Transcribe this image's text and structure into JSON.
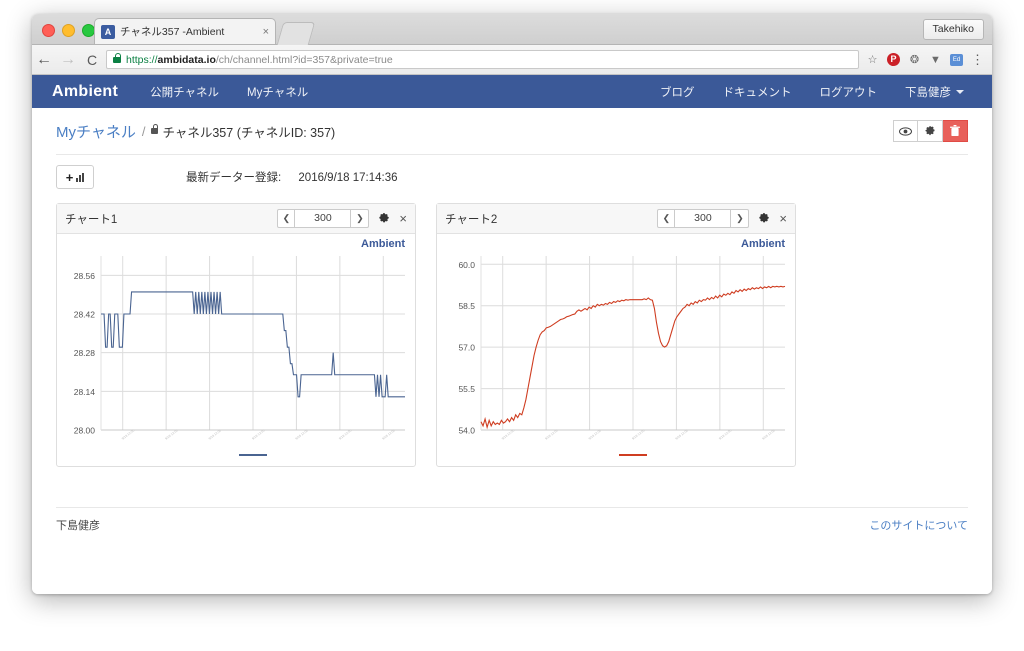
{
  "browser": {
    "tab_favicon": "A",
    "tab_title": "チャネル357 -Ambient",
    "tab_close_icon": "×",
    "profile_label": "Takehiko",
    "back_icon": "←",
    "forward_icon": "→",
    "reload_icon": "C",
    "url_scheme": "https://",
    "url_host": "ambidata.io",
    "url_path": "/ch/channel.html?id=357&private=true",
    "star_icon": "☆",
    "pinterest_icon": "P",
    "ext_icon": "❂",
    "shield_icon": "▼",
    "bluebox_icon": "Ed",
    "kebab_icon": "⋮"
  },
  "navbar": {
    "brand": "Ambient",
    "left_links": [
      {
        "label": "公開チャネル"
      },
      {
        "label": "Myチャネル"
      }
    ],
    "right_links": [
      {
        "label": "ブログ"
      },
      {
        "label": "ドキュメント"
      },
      {
        "label": "ログアウト"
      }
    ],
    "user": "下島健彦"
  },
  "titlerow": {
    "breadcrumb_link": "Myチャネル",
    "separator": "/",
    "channel_text": "チャネル357 (チャネルID: 357)",
    "view_icon": "👁",
    "settings_icon": "✿",
    "delete_icon": "🗑"
  },
  "toolbar": {
    "add_chart_plus": "+",
    "latest_label": "最新データー登録:",
    "latest_value": "2016/9/18 17:14:36"
  },
  "charts": [
    {
      "title": "チャート1",
      "prev_icon": "❮",
      "count": "300",
      "next_icon": "❯",
      "gear_icon": "✿",
      "close_icon": "×",
      "watermark": "Ambient"
    },
    {
      "title": "チャート2",
      "prev_icon": "❮",
      "count": "300",
      "next_icon": "❯",
      "gear_icon": "✿",
      "close_icon": "×",
      "watermark": "Ambient"
    }
  ],
  "footer": {
    "left": "下島健彦",
    "right_link": "このサイトについて"
  },
  "chart_data": [
    {
      "type": "line",
      "title": "チャート1",
      "xlabel": "",
      "ylabel": "",
      "grid": true,
      "legend_position": "bottom",
      "line_color": "#4a6491",
      "ylim": [
        28.0,
        28.63
      ],
      "yticks": [
        28.0,
        28.14,
        28.28,
        28.42,
        28.56
      ],
      "ytick_labels": [
        "28.00",
        "28.14",
        "28.28",
        "28.42",
        "28.56"
      ],
      "xticks": 7,
      "xtick_labels": [
        "",
        "",
        "",
        "",
        "",
        "",
        ""
      ],
      "n_points": 300,
      "values": [
        28.42,
        28.42,
        28.42,
        28.3,
        28.3,
        28.42,
        28.42,
        28.3,
        28.3,
        28.42,
        28.42,
        28.42,
        28.3,
        28.3,
        28.3,
        28.42,
        28.42,
        28.42,
        28.42,
        28.42,
        28.5,
        28.5,
        28.5,
        28.5,
        28.5,
        28.5,
        28.5,
        28.5,
        28.5,
        28.5,
        28.5,
        28.5,
        28.5,
        28.5,
        28.5,
        28.5,
        28.5,
        28.5,
        28.5,
        28.5,
        28.5,
        28.5,
        28.5,
        28.5,
        28.5,
        28.5,
        28.5,
        28.5,
        28.5,
        28.5,
        28.5,
        28.5,
        28.5,
        28.5,
        28.5,
        28.5,
        28.5,
        28.5,
        28.5,
        28.5,
        28.5,
        28.42,
        28.5,
        28.42,
        28.5,
        28.42,
        28.5,
        28.42,
        28.5,
        28.42,
        28.5,
        28.42,
        28.5,
        28.42,
        28.5,
        28.42,
        28.5,
        28.42,
        28.5,
        28.42,
        28.42,
        28.42,
        28.42,
        28.42,
        28.42,
        28.42,
        28.42,
        28.42,
        28.42,
        28.42,
        28.42,
        28.42,
        28.42,
        28.42,
        28.42,
        28.42,
        28.42,
        28.42,
        28.42,
        28.42,
        28.42,
        28.42,
        28.42,
        28.42,
        28.42,
        28.42,
        28.42,
        28.42,
        28.42,
        28.42,
        28.42,
        28.42,
        28.42,
        28.42,
        28.42,
        28.42,
        28.42,
        28.42,
        28.42,
        28.42,
        28.36,
        28.36,
        28.3,
        28.3,
        28.24,
        28.24,
        28.2,
        28.2,
        28.2,
        28.12,
        28.12,
        28.2,
        28.2,
        28.2,
        28.2,
        28.2,
        28.2,
        28.2,
        28.2,
        28.2,
        28.2,
        28.2,
        28.2,
        28.2,
        28.2,
        28.2,
        28.2,
        28.2,
        28.2,
        28.2,
        28.2,
        28.2,
        28.28,
        28.2,
        28.2,
        28.2,
        28.2,
        28.2,
        28.2,
        28.2,
        28.2,
        28.2,
        28.2,
        28.2,
        28.2,
        28.2,
        28.2,
        28.2,
        28.2,
        28.2,
        28.2,
        28.2,
        28.2,
        28.2,
        28.2,
        28.2,
        28.2,
        28.2,
        28.2,
        28.2,
        28.12,
        28.2,
        28.12,
        28.2,
        28.12,
        28.12,
        28.12,
        28.2,
        28.12,
        28.12,
        28.12,
        28.12,
        28.12,
        28.12,
        28.12,
        28.12,
        28.12,
        28.12,
        28.12,
        28.12
      ]
    },
    {
      "type": "line",
      "title": "チャート2",
      "xlabel": "",
      "ylabel": "",
      "grid": true,
      "legend_position": "bottom",
      "line_color": "#cf3d21",
      "ylim": [
        54.0,
        60.3
      ],
      "yticks": [
        54.0,
        55.5,
        57.0,
        58.5,
        60.0
      ],
      "ytick_labels": [
        "54.0",
        "55.5",
        "57.0",
        "58.5",
        "60.0"
      ],
      "xticks": 7,
      "xtick_labels": [
        "",
        "",
        "",
        "",
        "",
        "",
        ""
      ],
      "n_points": 300,
      "values": [
        54.3,
        54.15,
        54.4,
        54.1,
        54.35,
        54.15,
        54.3,
        54.2,
        54.25,
        54.2,
        54.35,
        54.25,
        54.3,
        54.4,
        54.3,
        54.45,
        54.35,
        54.55,
        54.45,
        54.6,
        54.55,
        54.8,
        55.1,
        55.5,
        55.9,
        56.3,
        56.7,
        57.0,
        57.25,
        57.45,
        57.55,
        57.6,
        57.7,
        57.72,
        57.75,
        57.8,
        57.85,
        57.9,
        57.95,
        58.0,
        58.02,
        58.05,
        58.1,
        58.12,
        58.15,
        58.18,
        58.2,
        58.3,
        58.35,
        58.3,
        58.35,
        58.4,
        58.35,
        58.45,
        58.4,
        58.5,
        58.45,
        58.55,
        58.5,
        58.55,
        58.52,
        58.58,
        58.55,
        58.62,
        58.58,
        58.65,
        58.62,
        58.68,
        58.65,
        58.7,
        58.68,
        58.72,
        58.7,
        58.72,
        58.72,
        58.72,
        58.72,
        58.72,
        58.72,
        58.72,
        58.75,
        58.72,
        58.78,
        58.72,
        58.7,
        58.4,
        57.9,
        57.5,
        57.2,
        57.05,
        57.0,
        57.05,
        57.2,
        57.45,
        57.7,
        57.95,
        58.1,
        58.2,
        58.3,
        58.4,
        58.45,
        58.55,
        58.5,
        58.6,
        58.55,
        58.65,
        58.6,
        58.7,
        58.65,
        58.72,
        58.7,
        58.78,
        58.72,
        58.8,
        58.75,
        58.85,
        58.78,
        58.88,
        58.82,
        58.92,
        58.88,
        58.95,
        58.9,
        59.0,
        58.95,
        59.05,
        59.0,
        59.08,
        59.02,
        59.1,
        59.05,
        59.12,
        59.08,
        59.15,
        59.1,
        59.15,
        59.12,
        59.18,
        59.12,
        59.18,
        59.15,
        59.2,
        59.15,
        59.2,
        59.18,
        59.2,
        59.18,
        59.2,
        59.18,
        59.2
      ]
    }
  ]
}
